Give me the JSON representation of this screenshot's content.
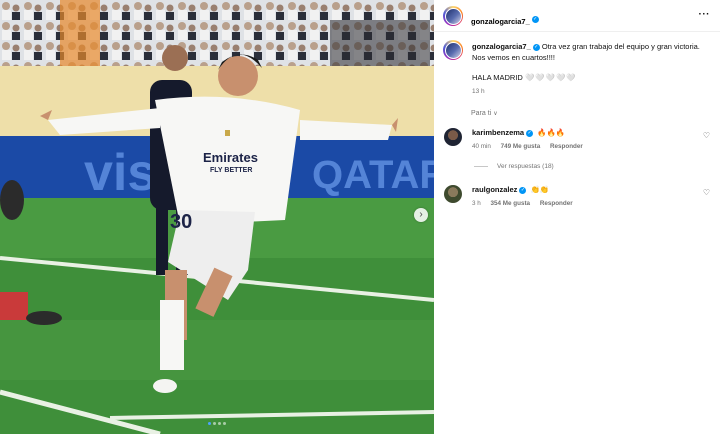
{
  "post": {
    "author": "gonzalogarcia7_",
    "caption": "Otra vez gran trabajo del equipo y gran victoria. Nos vemos en cuartos!!!!",
    "hala_text": "HALA MADRID",
    "hearts": "🤍🤍🤍🤍🤍",
    "time": "13 h",
    "more_icon": "···",
    "sort_label": "Para ti",
    "sort_chevron": "∨"
  },
  "photo": {
    "shirt_sponsor_line1": "Emirates",
    "shirt_sponsor_line2": "FLY BETTER",
    "shirt_number": "30",
    "board_text_left": "vis",
    "board_text_right": "QATAR",
    "next_arrow": "›",
    "dots_count": 4,
    "active_dot": 0
  },
  "comments": [
    {
      "user": "karimbenzema",
      "text": "🔥🔥🔥",
      "age": "40 min",
      "likes": "749 Me gusta",
      "reply": "Responder"
    },
    {
      "user": "raulgonzalez",
      "text": "👏👏",
      "age": "3 h",
      "likes": "354 Me gusta",
      "reply": "Responder"
    }
  ],
  "replies": {
    "label": "Ver respuestas (18)"
  },
  "colors": {
    "verified": "#0095f6",
    "meta_gray": "#737373",
    "grass": "#3f8f3a",
    "active_dot": "#4da3ff"
  }
}
